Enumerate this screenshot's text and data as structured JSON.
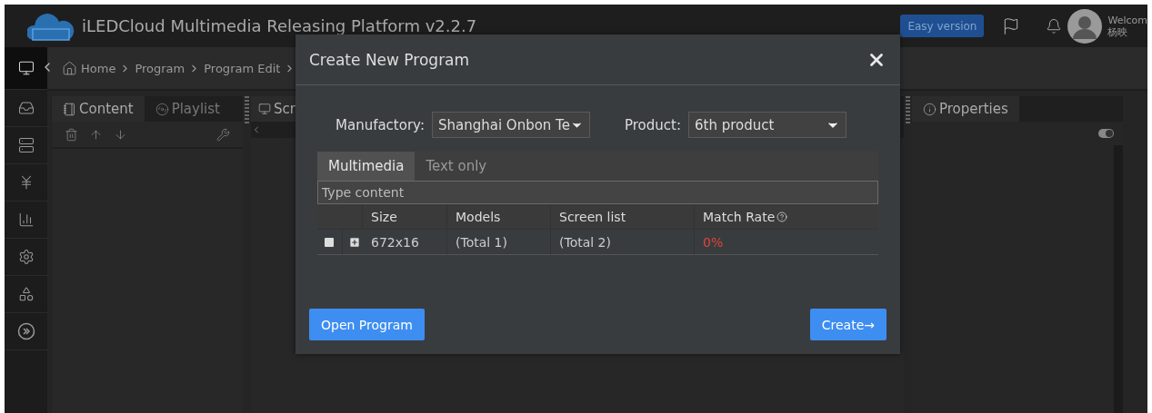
{
  "header": {
    "title": "iLEDCloud Multimedia Releasing Platform v2.2.7",
    "easy_button": "Easy version",
    "welcome": "Welcom",
    "user": "杨映"
  },
  "sidebar": {
    "items": [
      {
        "kind": "monitor",
        "selected": true
      },
      {
        "kind": "inbox",
        "selected": false
      },
      {
        "kind": "server",
        "selected": false
      },
      {
        "kind": "yen",
        "selected": false
      },
      {
        "kind": "chart",
        "selected": false
      },
      {
        "kind": "settings",
        "selected": false
      },
      {
        "kind": "apps",
        "selected": false
      },
      {
        "kind": "expand",
        "selected": false
      }
    ]
  },
  "breadcrumb": [
    "Home",
    "Program",
    "Program Edit"
  ],
  "left_panel": {
    "tabs": [
      {
        "label": "Content",
        "kind": "content",
        "selected": true
      },
      {
        "label": "Playlist",
        "kind": "playlist",
        "selected": false
      }
    ]
  },
  "middle_panel": {
    "tab": "Scr"
  },
  "right_panel": {
    "tab": "Properties",
    "toggle_on": true
  },
  "dialog": {
    "title": "Create New Program",
    "manufactory_label": "Manufactory:",
    "manufactory": "Shanghai Onbon Te",
    "product_label": "Product:",
    "product": "6th product",
    "tabs": [
      {
        "label": "Multimedia",
        "selected": true
      },
      {
        "label": "Text only",
        "selected": false
      }
    ],
    "search": {
      "placeholder": "Type content"
    },
    "table": {
      "columns": [
        "Size",
        "Models",
        "Screen list",
        "Match Rate"
      ],
      "rows": [
        {
          "checked": false,
          "expanded": false,
          "size": "672x16",
          "models": "(Total 1)",
          "screens": "(Total 2)",
          "match_rate": "0%"
        }
      ]
    },
    "buttons": {
      "open": "Open Program",
      "create": "Create→"
    }
  }
}
